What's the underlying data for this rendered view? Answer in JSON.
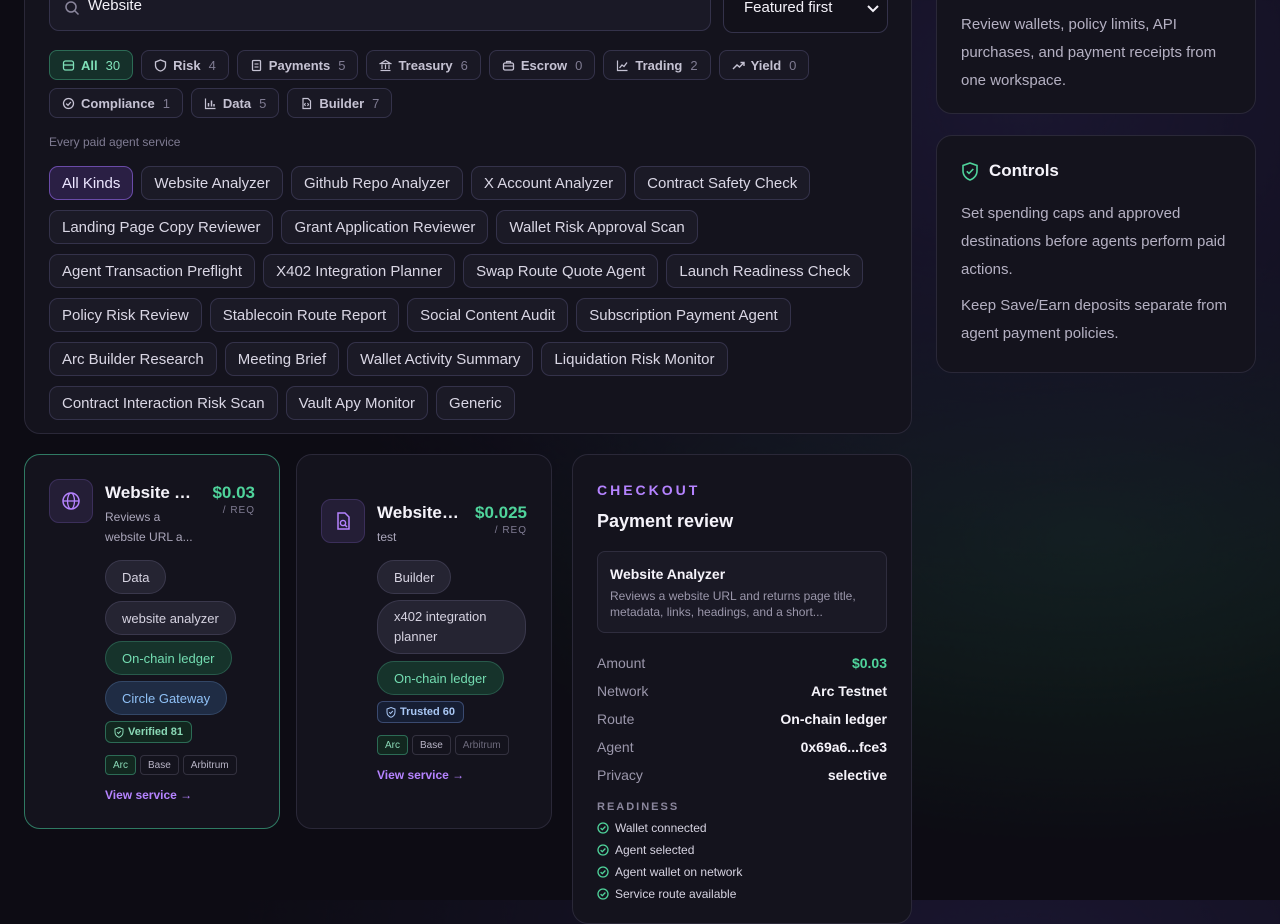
{
  "search": {
    "value": "Website"
  },
  "sort": {
    "selected": "Featured first"
  },
  "categories": [
    {
      "label": "All",
      "count": "30",
      "icon": "grid-icon",
      "active": true
    },
    {
      "label": "Risk",
      "count": "4",
      "icon": "shield-icon"
    },
    {
      "label": "Payments",
      "count": "5",
      "icon": "receipt-icon"
    },
    {
      "label": "Treasury",
      "count": "6",
      "icon": "bank-icon"
    },
    {
      "label": "Escrow",
      "count": "0",
      "icon": "briefcase-icon"
    },
    {
      "label": "Trading",
      "count": "2",
      "icon": "line-chart-icon"
    },
    {
      "label": "Yield",
      "count": "0",
      "icon": "trend-up-icon"
    },
    {
      "label": "Compliance",
      "count": "1",
      "icon": "check-circle-icon"
    },
    {
      "label": "Data",
      "count": "5",
      "icon": "bar-chart-icon"
    },
    {
      "label": "Builder",
      "count": "7",
      "icon": "file-code-icon"
    }
  ],
  "kinds_label": "Every paid agent service",
  "kinds": [
    "All Kinds",
    "Website Analyzer",
    "Github Repo Analyzer",
    "X Account Analyzer",
    "Contract Safety Check",
    "Landing Page Copy Reviewer",
    "Grant Application Reviewer",
    "Wallet Risk Approval Scan",
    "Agent Transaction Preflight",
    "X402 Integration Planner",
    "Swap Route Quote Agent",
    "Launch Readiness Check",
    "Policy Risk Review",
    "Stablecoin Route Report",
    "Social Content Audit",
    "Subscription Payment Agent",
    "Arc Builder Research",
    "Meeting Brief",
    "Wallet Activity Summary",
    "Liquidation Risk Monitor",
    "Contract Interaction Risk Scan",
    "Vault Apy Monitor",
    "Generic"
  ],
  "cards": [
    {
      "title": "Website Analyzer",
      "price": "$0.03",
      "unit": "/ REQ",
      "desc_1": "Reviews a",
      "desc_2": "website URL a...",
      "tags": [
        "Data",
        "website analyzer"
      ],
      "route": "On-chain ledger",
      "gateway": "Circle Gateway",
      "badge": "Verified 81",
      "chains": [
        "Arc",
        "Base",
        "Arbitrum"
      ],
      "link": "View service →"
    },
    {
      "title": "Website Analyzer",
      "price": "$0.025",
      "unit": "/ REQ",
      "desc": "test",
      "tag": "Builder",
      "tag2_line1": "x402 integration",
      "tag2_line2": "planner",
      "route": "On-chain ledger",
      "badge": "Trusted 60",
      "chains": [
        "Arc",
        "Base",
        "Arbitrum"
      ],
      "link": "View service →"
    }
  ],
  "checkout": {
    "eyebrow": "CHECKOUT",
    "title": "Payment review",
    "service_name": "Website Analyzer",
    "service_desc": "Reviews a website URL and returns page title, metadata, links, headings, and a short...",
    "rows": [
      {
        "k": "Amount",
        "v": "$0.03"
      },
      {
        "k": "Network",
        "v": "Arc Testnet"
      },
      {
        "k": "Route",
        "v": "On-chain ledger"
      },
      {
        "k": "Agent",
        "v": "0x69a6...fce3"
      },
      {
        "k": "Privacy",
        "v": "selective"
      }
    ],
    "readiness_label": "READINESS",
    "readiness": [
      "Wallet connected",
      "Agent selected",
      "Agent wallet on network",
      "Service route available"
    ]
  },
  "info": {
    "text": "Review wallets, policy limits, API purchases, and payment receipts from one workspace."
  },
  "controls": {
    "title": "Controls",
    "p1": "Set spending caps and approved destinations before agents perform paid actions.",
    "p2": "Keep Save/Earn deposits separate from agent payment policies."
  },
  "colors": {
    "accent": "#b583ff",
    "green": "#4fd39b",
    "bg": "#0d0c14"
  }
}
